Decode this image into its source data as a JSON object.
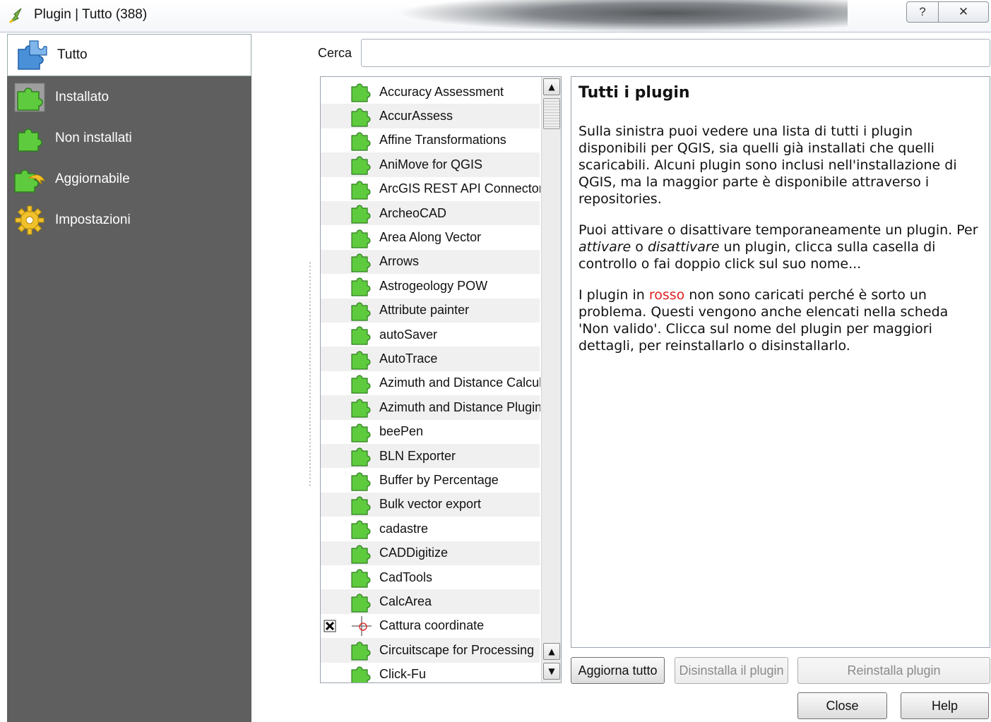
{
  "window": {
    "title": "Plugin | Tutto (388)",
    "help_glyph": "?",
    "close_glyph": "✕"
  },
  "sidebar": {
    "items": [
      {
        "label": "Tutto",
        "icon": "puzzle-blue-icon"
      },
      {
        "label": "Installato",
        "icon": "puzzle-green-icon"
      },
      {
        "label": "Non installati",
        "icon": "puzzle-green-small-icon"
      },
      {
        "label": "Aggiornabile",
        "icon": "puzzle-upgrade-icon"
      },
      {
        "label": "Impostazioni",
        "icon": "gear-icon"
      }
    ]
  },
  "search": {
    "label": "Cerca",
    "value": "",
    "placeholder": ""
  },
  "plugin_list": {
    "items": [
      {
        "label": "Accuracy Assessment"
      },
      {
        "label": "AccurAssess"
      },
      {
        "label": "Affine Transformations"
      },
      {
        "label": "AniMove for QGIS"
      },
      {
        "label": "ArcGIS REST API Connector"
      },
      {
        "label": "ArcheoCAD"
      },
      {
        "label": "Area Along Vector"
      },
      {
        "label": "Arrows"
      },
      {
        "label": "Astrogeology POW"
      },
      {
        "label": "Attribute painter"
      },
      {
        "label": "autoSaver"
      },
      {
        "label": "AutoTrace"
      },
      {
        "label": "Azimuth and Distance Calculator"
      },
      {
        "label": "Azimuth and Distance Plugin"
      },
      {
        "label": "beePen"
      },
      {
        "label": "BLN Exporter"
      },
      {
        "label": "Buffer by Percentage"
      },
      {
        "label": "Bulk vector export"
      },
      {
        "label": "cadastre"
      },
      {
        "label": "CADDigitize"
      },
      {
        "label": "CadTools"
      },
      {
        "label": "CalcArea"
      },
      {
        "label": "Cattura coordinate"
      },
      {
        "label": "Circuitscape for Processing"
      },
      {
        "label": "Click-Fu"
      }
    ],
    "checked_label": "Cattura coordinate"
  },
  "description": {
    "title": "Tutti i plugin",
    "p1": "Sulla sinistra puoi vedere una lista di tutti i plugin disponibili per QGIS, sia quelli già installati che quelli scaricabili. Alcuni plugin sono inclusi nell'installazione di QGIS, ma la maggior parte è disponibile attraverso i repositories.",
    "p2_a": "Puoi attivare o disattivare temporaneamente un plugin. Per ",
    "p2_em1": "attivare",
    "p2_b": " o ",
    "p2_em2": "disattivare",
    "p2_c": " un plugin, clicca sulla casella di controllo o fai doppio click sul suo nome...",
    "p3_a": "I plugin in ",
    "p3_red": "rosso",
    "p3_b": " non sono caricati perché è sorto un problema. Questi vengono anche elencati nella scheda 'Non valido'. Clicca sul nome del plugin per maggiori dettagli, per reinstallarlo o disinstallarlo."
  },
  "buttons": {
    "upgrade_all": "Aggiorna tutto",
    "uninstall": "Disinstalla il plugin",
    "reinstall": "Reinstalla plugin",
    "close": "Close",
    "help": "Help"
  },
  "colors": {
    "sidebar_bg": "#5f5f5f",
    "invalid_red": "#e02020",
    "plugin_green": "#39b54a"
  }
}
